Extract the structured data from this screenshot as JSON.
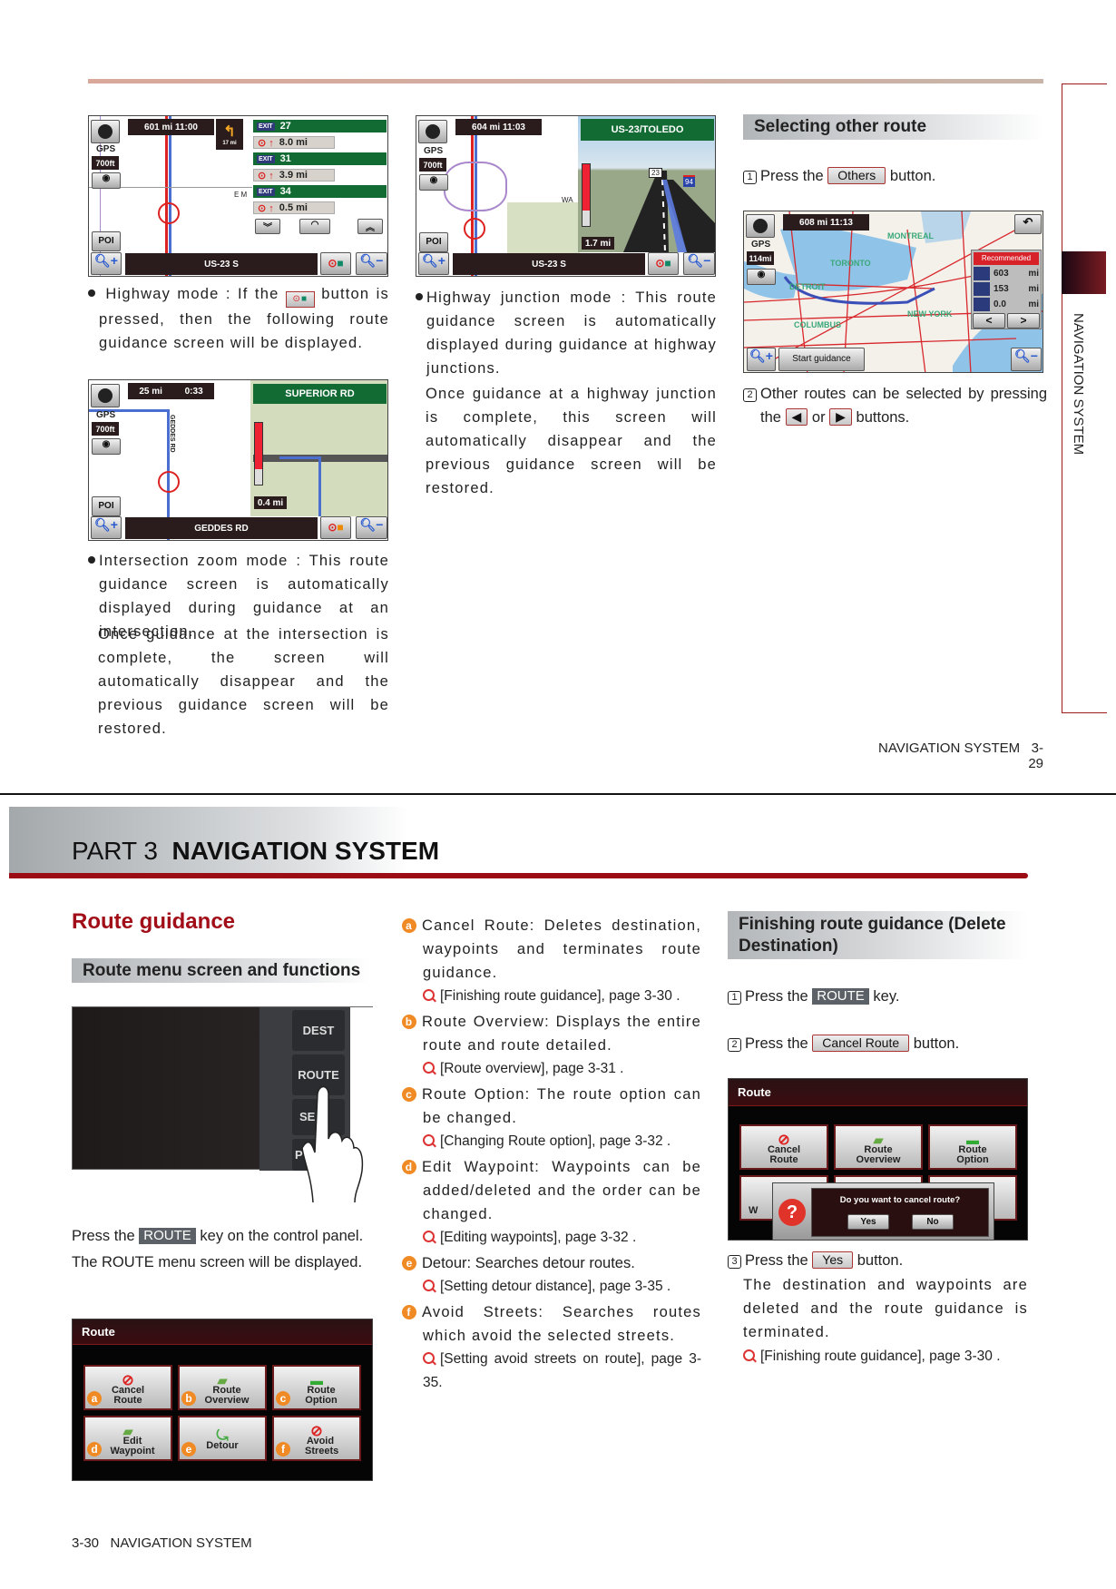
{
  "top_page": {
    "highway_screen": {
      "info": "601 mi 11:00",
      "turn_dist": "17 mi",
      "gps": "GPS",
      "scale": "700ft",
      "poi": "POI",
      "road_label": "E M",
      "exits": [
        {
          "exit": "EXIT",
          "num": "27",
          "dist": "8.0 mi"
        },
        {
          "exit": "EXIT",
          "num": "31",
          "dist": "3.9 mi"
        },
        {
          "exit": "EXIT",
          "num": "34",
          "dist": "0.5 mi"
        }
      ],
      "street": "US-23 S"
    },
    "highway_text": "Highway mode : If the",
    "highway_text2": "button is pressed, then the following route guidance screen will be displayed.",
    "intersection_screen": {
      "info_dist": "25 mi",
      "info_time": "0:33",
      "gps": "GPS",
      "scale": "700ft",
      "poi": "POI",
      "sign": "SUPERIOR RD",
      "side_road": "GEDDES RD",
      "dist": "0.4 mi",
      "street": "GEDDES RD"
    },
    "intersection_text": "Intersection zoom mode : This route guidance screen is automatically displayed during guidance at an intersection.",
    "intersection_text2": "Once guidance at the intersection is complete, the screen will automatically disappear and the previous guidance screen will be restored.",
    "junction_screen": {
      "info": "604 mi 11:03",
      "gps": "GPS",
      "scale": "700ft",
      "poi": "POI",
      "sign": "US-23/TOLEDO",
      "shield1": "23",
      "shield2": "94",
      "road_label": "WA",
      "dist": "1.7 mi",
      "street": "US-23 S"
    },
    "junction_text": "Highway junction mode : This route guidance screen is automatically displayed during guidance at highway junctions.",
    "junction_text2": "Once guidance at a highway junction is complete, this screen will automatically disappear and the previous guidance screen will be restored.",
    "selecting_title": "Selecting other route",
    "step1": {
      "num": "1",
      "pre": "Press the",
      "button": "Others",
      "post": "button."
    },
    "route_map_screen": {
      "info": "608 mi 11:13",
      "gps": "GPS",
      "scale": "114mi",
      "recommended": "Recommended",
      "rows": [
        {
          "value": "603",
          "unit": "mi"
        },
        {
          "value": "153",
          "unit": "mi"
        },
        {
          "value": "0.0",
          "unit": "mi"
        }
      ],
      "start": "Start guidance",
      "cities": [
        "TORONTO",
        "DETROIT",
        "NEW YORK",
        "COLUMBUS",
        "MONTREAL"
      ],
      "prev": "<",
      "next": ">"
    },
    "step2": {
      "num": "2",
      "pre": "Other routes can be selected by pressing the",
      "or": "or",
      "post": "buttons.",
      "left": "◀",
      "right": "▶"
    },
    "side_tab": "NAVIGATION SYSTEM",
    "footer": {
      "section": "NAVIGATION SYSTEM",
      "page": "3-29"
    }
  },
  "bottom_page": {
    "part": "PART 3",
    "part_title": "NAVIGATION SYSTEM",
    "heading": "Route guidance",
    "subheading": "Route menu screen and functions",
    "panel": {
      "keys": [
        "DEST",
        "ROUTE",
        "SE",
        "P"
      ]
    },
    "press_text": {
      "pre": "Press the",
      "key": "ROUTE",
      "post": "key on the control panel."
    },
    "displayed_text": "The ROUTE menu screen will be displayed.",
    "route_menu": {
      "title": "Route",
      "items": [
        {
          "mark": "a",
          "label": "Cancel Route"
        },
        {
          "mark": "b",
          "label": "Route Overview"
        },
        {
          "mark": "c",
          "label": "Route Option"
        },
        {
          "mark": "d",
          "label": "Edit Waypoint"
        },
        {
          "mark": "e",
          "label": "Detour"
        },
        {
          "mark": "f",
          "label": "Avoid Streets"
        }
      ]
    },
    "functions": [
      {
        "mark": "a",
        "text": "Cancel Route: Deletes destination, waypoints and terminates route guidance.",
        "ref": "[Finishing route guidance], page 3-30 ."
      },
      {
        "mark": "b",
        "text": "Route Overview: Displays the entire route and route detailed.",
        "ref": "[Route overview], page 3-31 ."
      },
      {
        "mark": "c",
        "text": "Route Option: The route option can be changed.",
        "ref": "[Changing Route option], page 3-32 ."
      },
      {
        "mark": "d",
        "text": "Edit Waypoint: Waypoints can be added/deleted and the order can be changed.",
        "ref": "[Editing waypoints], page 3-32 ."
      },
      {
        "mark": "e",
        "text": "Detour: Searches detour routes.",
        "ref": "[Setting detour distance], page 3-35 ."
      },
      {
        "mark": "f",
        "text": "Avoid Streets: Searches routes which avoid the selected streets.",
        "ref": "[Setting avoid streets on route], page 3-35."
      }
    ],
    "finishing_title": "Finishing route guidance (Delete Destination)",
    "step1": {
      "num": "1",
      "pre": "Press the",
      "key": "ROUTE",
      "post": "key."
    },
    "step2": {
      "num": "2",
      "pre": "Press the",
      "button": "Cancel Route",
      "post": "button."
    },
    "dialog_screen": {
      "title": "Route",
      "tiles": [
        "Cancel Route",
        "Route Overview",
        "Route Option"
      ],
      "partial": "W",
      "question": "Do you want to cancel route?",
      "yes": "Yes",
      "no": "No"
    },
    "step3": {
      "num": "3",
      "pre": "Press the",
      "button": "Yes",
      "post": "button."
    },
    "step3_text": "The destination and waypoints are deleted and the route guidance is terminated.",
    "step3_ref": "[Finishing route guidance], page 3-30 .",
    "footer": {
      "page": "3-30",
      "section": "NAVIGATION SYSTEM"
    }
  },
  "colors": {
    "accent_red": "#9b0c14",
    "marker_orange": "#f08a24",
    "sign_green": "#136b34"
  }
}
